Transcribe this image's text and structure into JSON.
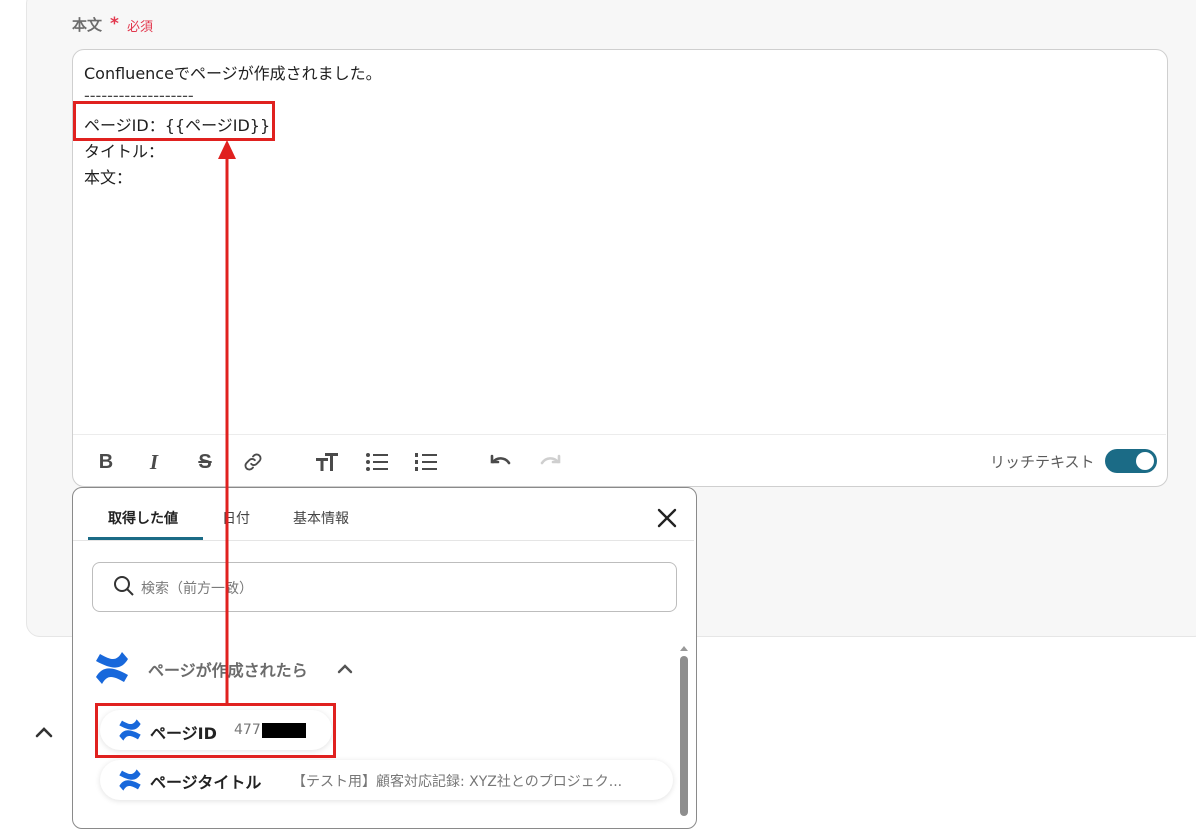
{
  "field": {
    "label": "本文",
    "required_mark": "*",
    "required_text": "必須"
  },
  "editor": {
    "lines": [
      "Confluenceでページが作成されました。",
      "-------------------",
      "ページID：{{ページID}}",
      "タイトル：",
      "本文："
    ]
  },
  "toolbar": {
    "buttons": [
      "bold",
      "italic",
      "strikethrough",
      "link",
      "text-size",
      "bullet-list",
      "numbered-list",
      "undo",
      "redo"
    ],
    "rich_text_label": "リッチテキスト",
    "rich_text_enabled": true
  },
  "popup": {
    "tabs": [
      {
        "label": "取得した値",
        "active": true
      },
      {
        "label": "日付",
        "active": false
      },
      {
        "label": "基本情報",
        "active": false
      }
    ],
    "search_placeholder": "検索（前方一致）",
    "group": {
      "title": "ページが作成されたら",
      "app_icon": "confluence-icon"
    },
    "items": [
      {
        "label": "ページID",
        "value": "477"
      },
      {
        "label": "ページタイトル",
        "value": "【テスト用】顧客対応記録: XYZ社とのプロジェク..."
      }
    ]
  },
  "colors": {
    "accent": "#1b6b86",
    "required": "#e2374d",
    "highlight": "#e0211f"
  }
}
